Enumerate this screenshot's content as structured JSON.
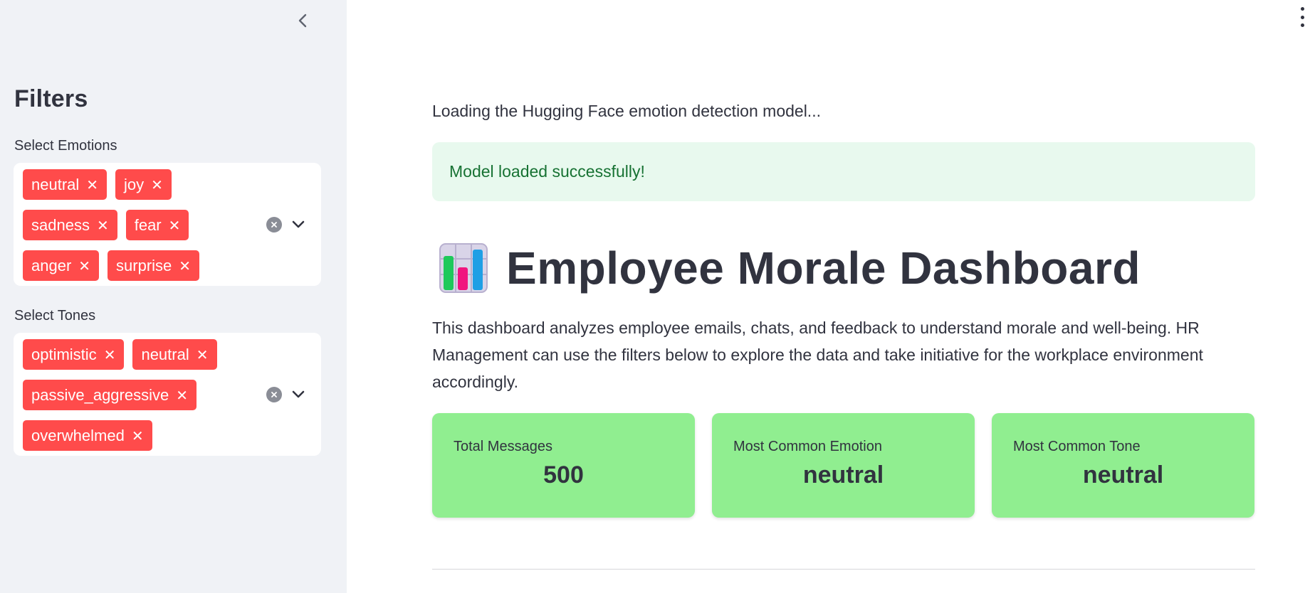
{
  "sidebar": {
    "title": "Filters",
    "emotions": {
      "label": "Select Emotions",
      "selected": [
        "neutral",
        "joy",
        "sadness",
        "fear",
        "anger",
        "surprise"
      ]
    },
    "tones": {
      "label": "Select Tones",
      "selected": [
        "optimistic",
        "neutral",
        "passive_aggressive",
        "overwhelmed"
      ]
    }
  },
  "main": {
    "loading_text": "Loading the Hugging Face emotion detection model...",
    "success_alert": "Model loaded successfully!",
    "title": "Employee Morale Dashboard",
    "title_icon": "bar-chart-icon",
    "description": "This dashboard analyzes employee emails, chats, and feedback to understand morale and well-being. HR Management can use the filters below to explore the data and take initiative for the workplace environment accordingly.",
    "metrics": [
      {
        "label": "Total Messages",
        "value": "500"
      },
      {
        "label": "Most Common Emotion",
        "value": "neutral"
      },
      {
        "label": "Most Common Tone",
        "value": "neutral"
      }
    ]
  },
  "colors": {
    "chip": "#ff4b4b",
    "sidebar_bg": "#f0f2f6",
    "metric_card": "#90ee90",
    "alert_bg": "#e8f9ee",
    "alert_text": "#177233"
  }
}
